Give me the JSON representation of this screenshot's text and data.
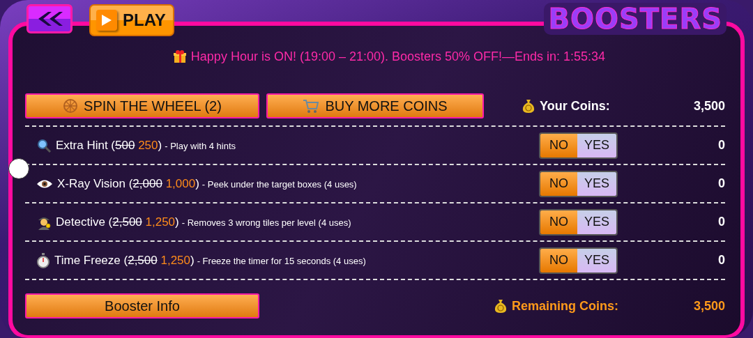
{
  "header": {
    "play_label": "PLAY",
    "title": "BOOSTERS"
  },
  "banner": "Happy Hour is ON! (19:00 – 21:00). Boosters 50% OFF!—Ends in: 1:55:34",
  "actions": [
    {
      "label": "SPIN THE WHEEL (2)"
    },
    {
      "label": "BUY MORE COINS"
    }
  ],
  "coins": {
    "label": "Your Coins:",
    "value": "3,500"
  },
  "boosters": [
    {
      "title_start": "Extra Hint (",
      "old_price": "500",
      "new_price": "250",
      "title_end": ")",
      "description": "- Play with 4 hints",
      "options": [
        {
          "label": "NO",
          "selected": true
        },
        {
          "label": "YES",
          "selected": false
        }
      ],
      "count": "0"
    },
    {
      "title_start": "X-Ray Vision (",
      "old_price": "2,000",
      "new_price": "1,000",
      "title_end": ")",
      "description": "- Peek under the target boxes (4 uses)",
      "options": [
        {
          "label": "NO",
          "selected": true
        },
        {
          "label": "YES",
          "selected": false
        }
      ],
      "count": "0"
    },
    {
      "title_start": "Detective (",
      "old_price": "2,500",
      "new_price": "1,250",
      "title_end": ")",
      "description": "- Removes 3 wrong tiles per level (4 uses)",
      "options": [
        {
          "label": "NO",
          "selected": true
        },
        {
          "label": "YES",
          "selected": false
        }
      ],
      "count": "0"
    },
    {
      "title_start": "Time Freeze (",
      "old_price": "2,500",
      "new_price": "1,250",
      "title_end": ")",
      "description": "- Freeze the timer for 15 seconds (4 uses)",
      "options": [
        {
          "label": "NO",
          "selected": true
        },
        {
          "label": "YES",
          "selected": false
        }
      ],
      "count": "0"
    }
  ],
  "footer": {
    "info_button": "Booster Info",
    "remaining_label": "Remaining Coins:",
    "remaining_value": "3,500"
  }
}
